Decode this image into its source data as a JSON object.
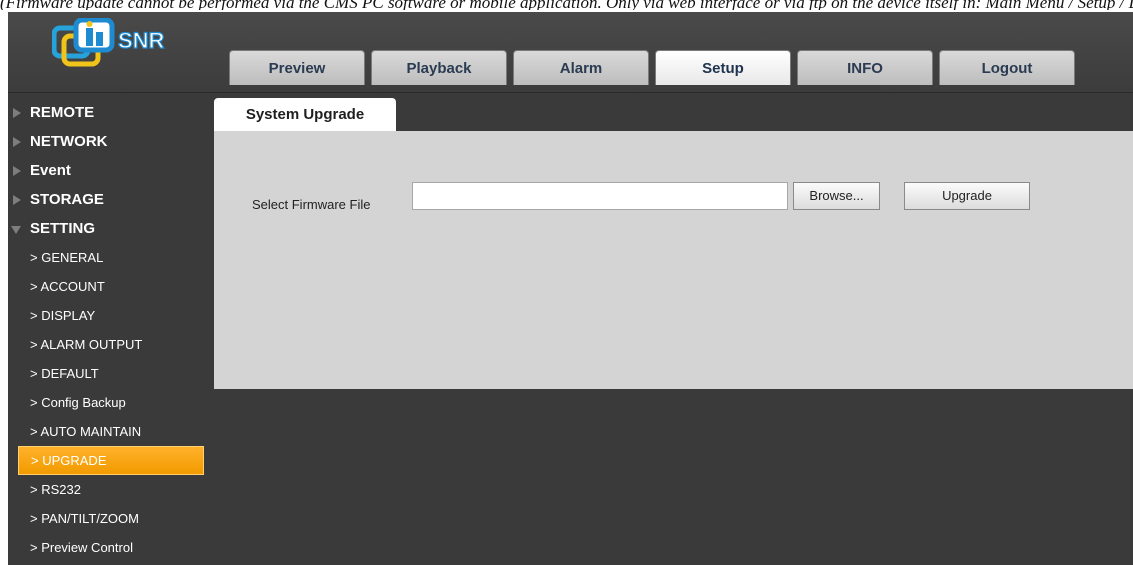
{
  "caption": "(Firmware update cannot be performed via the CMS PC software or mobile application. Only via web interface or via ftp on the device itself in: Main Menu / Setup / Display / Upgrade)",
  "logo": {
    "text": "SNR"
  },
  "header": {
    "tabs": [
      {
        "label": "Preview",
        "active": false
      },
      {
        "label": "Playback",
        "active": false
      },
      {
        "label": "Alarm",
        "active": false
      },
      {
        "label": "Setup",
        "active": true
      },
      {
        "label": "INFO",
        "active": false
      },
      {
        "label": "Logout",
        "active": false
      }
    ]
  },
  "sidebar": {
    "sections": [
      {
        "label": "REMOTE"
      },
      {
        "label": "NETWORK"
      },
      {
        "label": "Event"
      },
      {
        "label": "STORAGE"
      },
      {
        "label": "SETTING"
      }
    ],
    "items": [
      {
        "label": "> GENERAL"
      },
      {
        "label": "> ACCOUNT"
      },
      {
        "label": "> DISPLAY"
      },
      {
        "label": "> ALARM OUTPUT"
      },
      {
        "label": "> DEFAULT"
      },
      {
        "label": "> Config Backup"
      },
      {
        "label": "> AUTO MAINTAIN"
      },
      {
        "label": "> UPGRADE"
      },
      {
        "label": "> RS232"
      },
      {
        "label": "> PAN/TILT/ZOOM"
      },
      {
        "label": "> Preview Control"
      }
    ]
  },
  "main": {
    "tab": "System Upgrade",
    "firmware_label": "Select Firmware File",
    "firmware_value": "",
    "browse_label": "Browse...",
    "upgrade_label": "Upgrade"
  },
  "colors": {
    "accent": "#f5a00f",
    "background": "#3a3a3a",
    "panel": "#d4d4d4"
  }
}
